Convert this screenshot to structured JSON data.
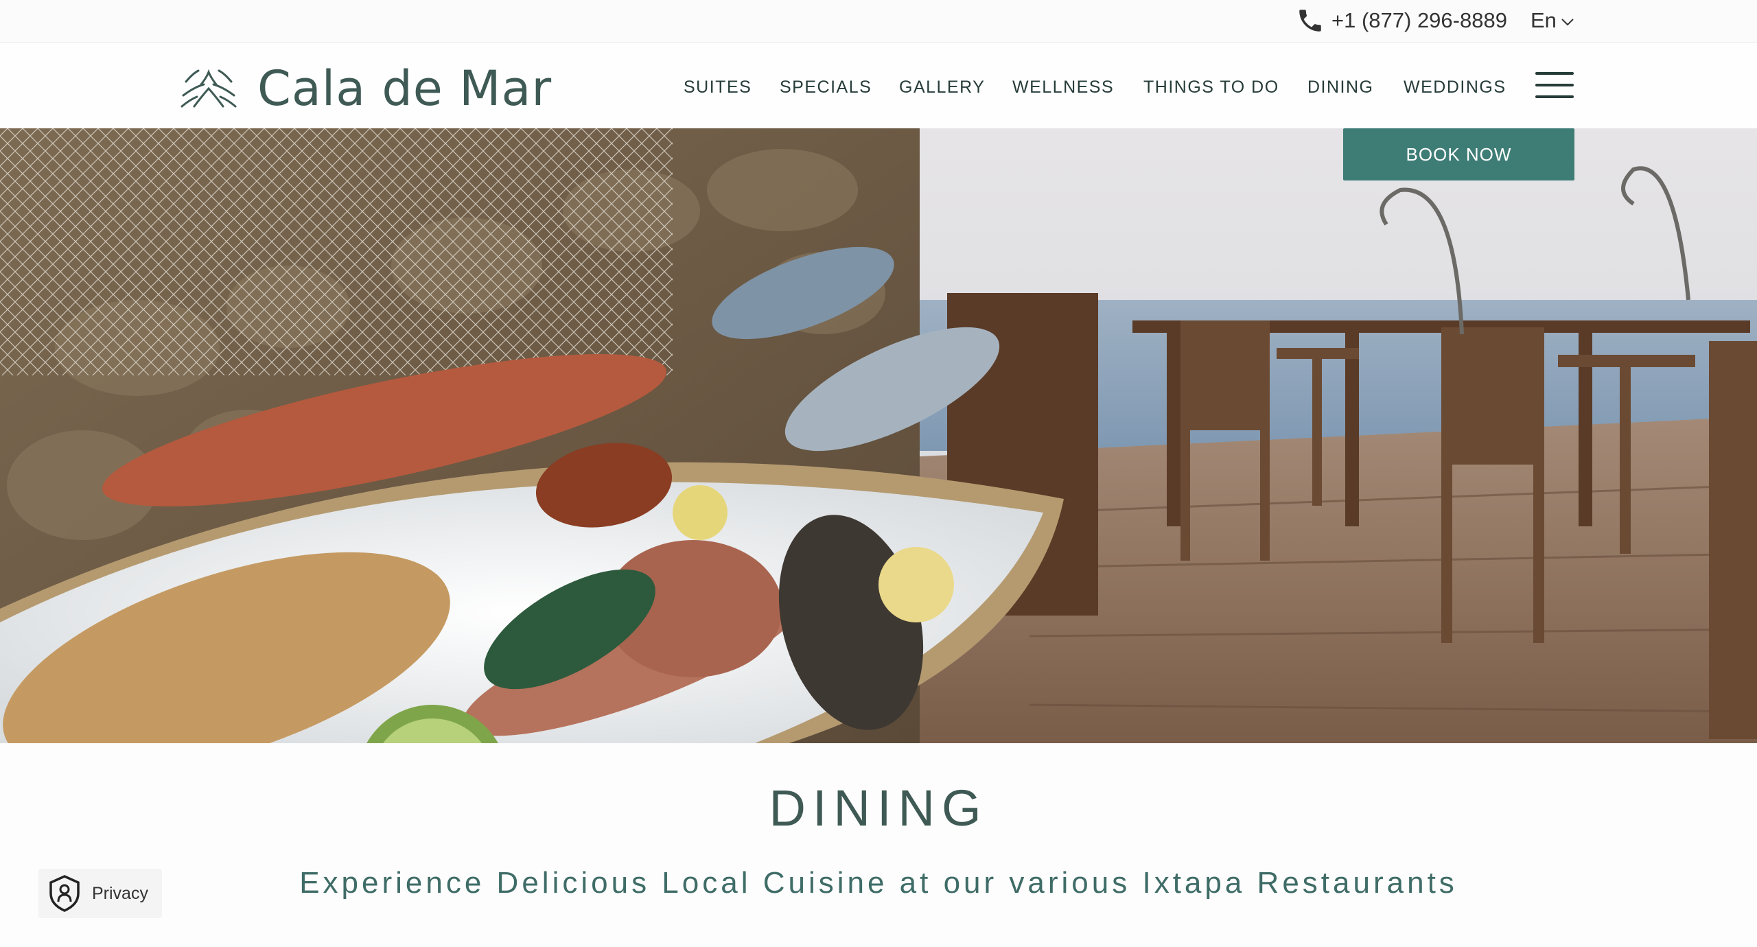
{
  "utility": {
    "phone": "+1 (877) 296-8889",
    "language": "En"
  },
  "header": {
    "logo_text": "Cala de Mar",
    "nav": [
      "SUITES",
      "SPECIALS",
      "GALLERY",
      "WELLNESS",
      "THINGS TO DO",
      "DINING",
      "WEDDINGS"
    ]
  },
  "hero": {
    "book_label": "BOOK NOW"
  },
  "content": {
    "title": "DINING",
    "subtitle": "Experience Delicious Local Cuisine at our various Ixtapa Restaurants"
  },
  "privacy": {
    "label": "Privacy"
  },
  "colors": {
    "accent": "#3e7d76",
    "text": "#3f5a55",
    "nav_text": "#263c39"
  },
  "icons": [
    "phone-icon",
    "chevron-down-icon",
    "logo-mark-icon",
    "hamburger-menu-icon",
    "privacy-shield-icon"
  ]
}
